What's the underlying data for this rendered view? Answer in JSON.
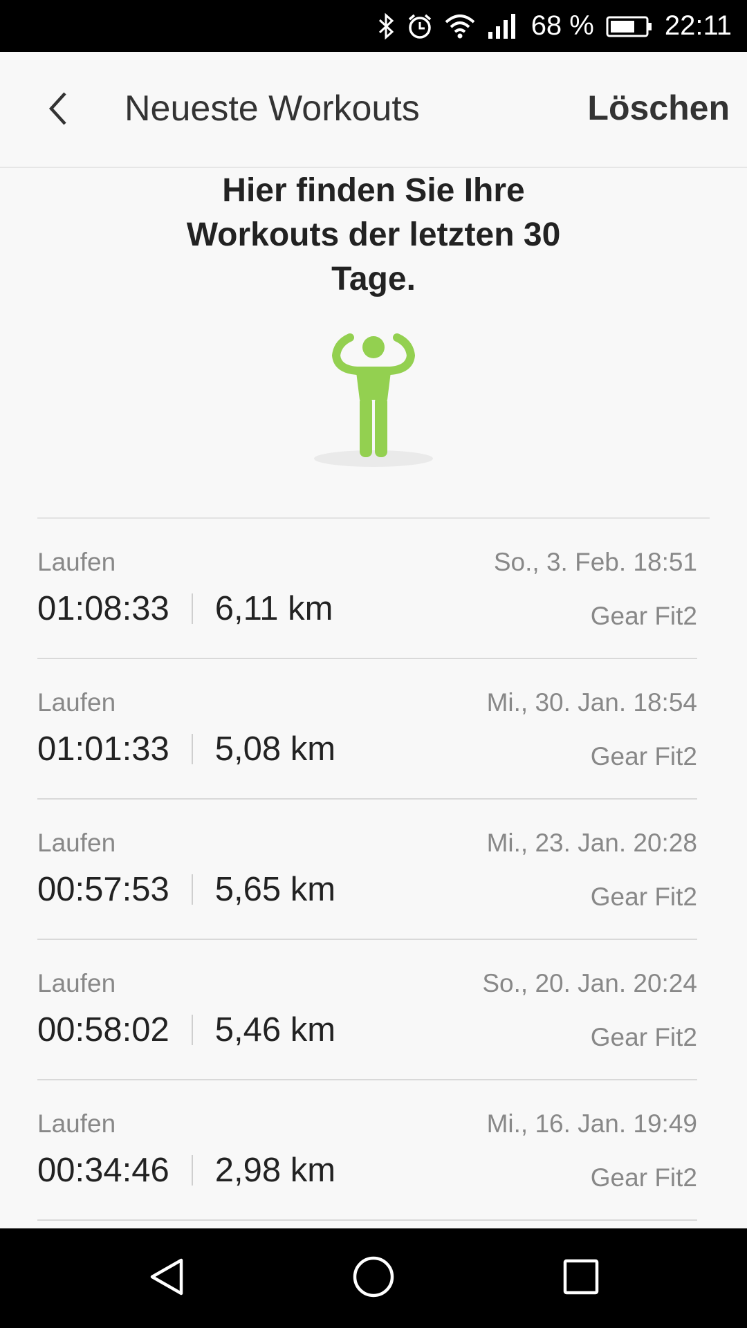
{
  "status_bar": {
    "battery_percent": "68 %",
    "time": "22:11",
    "icons": [
      "bluetooth-icon",
      "alarm-icon",
      "wifi-icon",
      "signal-icon",
      "battery-icon"
    ]
  },
  "app_bar": {
    "title": "Neueste Workouts",
    "delete_label": "Löschen"
  },
  "intro": {
    "line1": "Hier finden Sie Ihre",
    "line2": "Workouts der letzten 30",
    "line3": "Tage."
  },
  "colors": {
    "figure_green": "#93d050",
    "shadow": "#eaeaea"
  },
  "workouts": [
    {
      "type": "Laufen",
      "date": "So., 3. Feb. 18:51",
      "duration": "01:08:33",
      "distance": "6,11 km",
      "device": "Gear Fit2"
    },
    {
      "type": "Laufen",
      "date": "Mi., 30. Jan. 18:54",
      "duration": "01:01:33",
      "distance": "5,08 km",
      "device": "Gear Fit2"
    },
    {
      "type": "Laufen",
      "date": "Mi., 23. Jan. 20:28",
      "duration": "00:57:53",
      "distance": "5,65 km",
      "device": "Gear Fit2"
    },
    {
      "type": "Laufen",
      "date": "So., 20. Jan. 20:24",
      "duration": "00:58:02",
      "distance": "5,46 km",
      "device": "Gear Fit2"
    },
    {
      "type": "Laufen",
      "date": "Mi., 16. Jan. 19:49",
      "duration": "00:34:46",
      "distance": "2,98 km",
      "device": "Gear Fit2"
    }
  ]
}
